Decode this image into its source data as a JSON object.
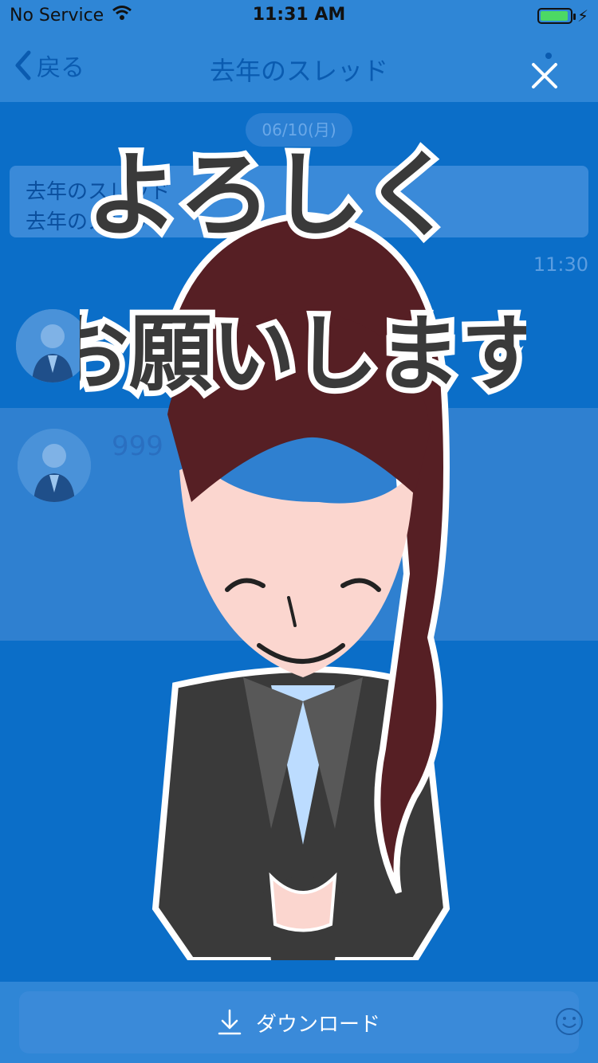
{
  "status": {
    "carrier": "No Service",
    "time": "11:31 AM"
  },
  "nav": {
    "back": "戻る",
    "title": "去年のスレッド"
  },
  "chat": {
    "date": "06/10(月)",
    "message_line1": "去年のスレッド",
    "message_line2": "去年のスレッド",
    "time": "11:30",
    "faint_number": "999"
  },
  "sticker": {
    "line1": "よろしく",
    "line2": "お願いします"
  },
  "footer": {
    "download_label": "ダウンロード"
  },
  "colors": {
    "overlay_blue": "#0b6ec8",
    "accent": "#2f86d6"
  }
}
